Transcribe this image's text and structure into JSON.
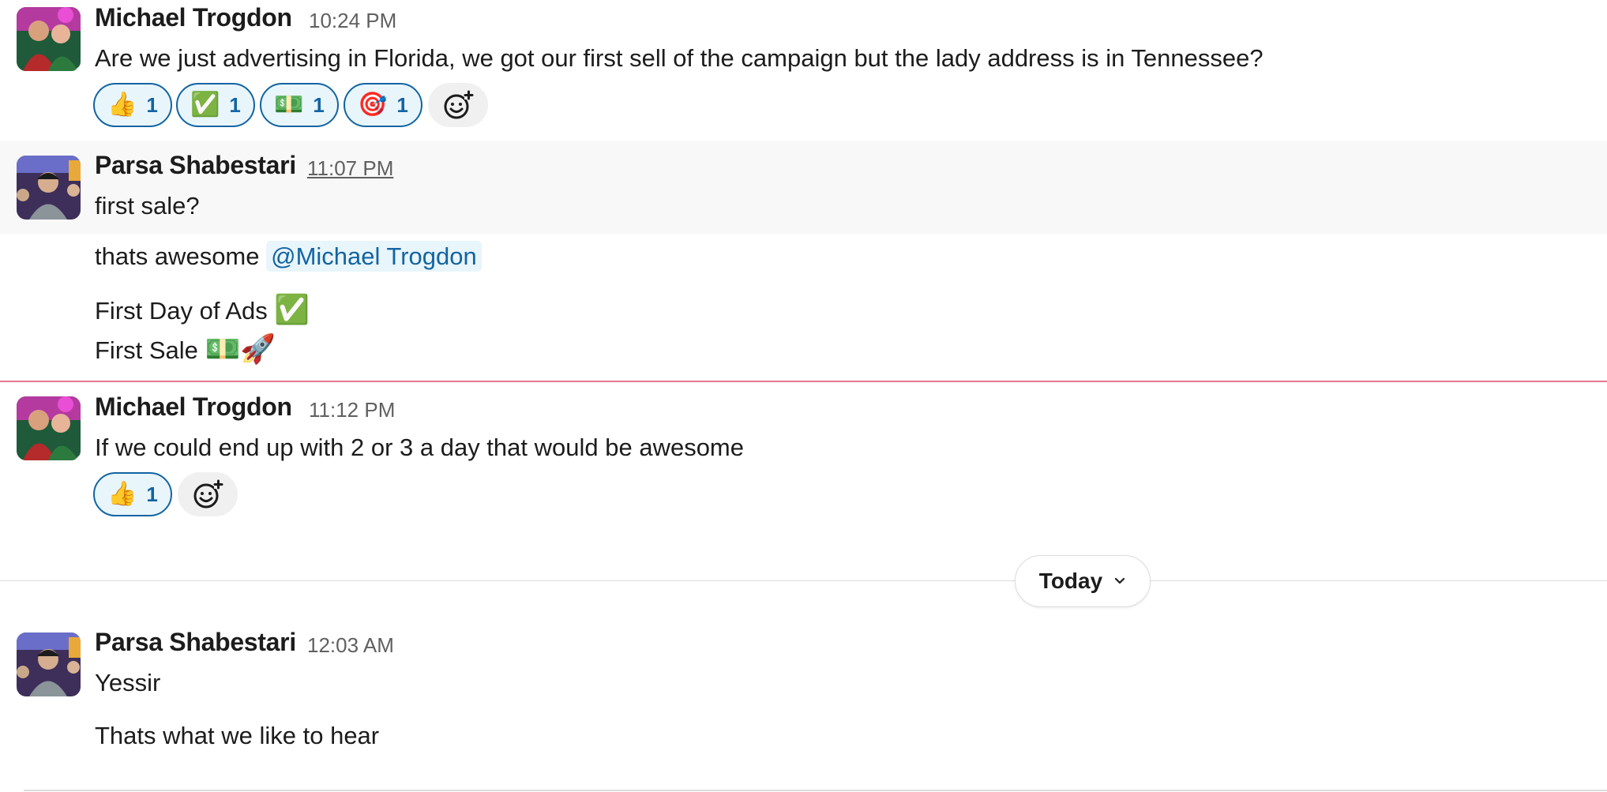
{
  "messages": [
    {
      "author": "Michael Trogdon",
      "time": "10:24 PM",
      "text": "Are we just advertising in Florida, we got our first sell of the campaign but the lady address is in Tennessee?",
      "reactions": [
        {
          "emoji": "👍",
          "count": "1"
        },
        {
          "emoji": "✅",
          "count": "1"
        },
        {
          "emoji": "💵",
          "count": "1"
        },
        {
          "emoji": "🎯",
          "count": "1"
        }
      ]
    },
    {
      "author": "Parsa Shabestari",
      "time": "11:07 PM",
      "text": "first sale?",
      "followups": {
        "line1_prefix": "thats awesome ",
        "mention": "@Michael Trogdon",
        "line2": "First Day of Ads",
        "line2_emoji": "✅",
        "line3": "First Sale",
        "line3_emoji": "💵🚀"
      }
    },
    {
      "author": "Michael Trogdon",
      "time": "11:12 PM",
      "text": "If we could end up with 2 or 3 a day that would be awesome",
      "reactions": [
        {
          "emoji": "👍",
          "count": "1"
        }
      ]
    },
    {
      "author": "Parsa Shabestari",
      "time": "12:03 AM",
      "text": "Yessir",
      "followup": "Thats what we like to hear"
    }
  ],
  "date_divider": {
    "label": "Today",
    "icon": "chevron-down-icon"
  },
  "colors": {
    "mention_bg": "#e8f5fa",
    "mention_text": "#1264a3",
    "reaction_border": "#1264a3",
    "new_messages_line": "#e8768f",
    "hover_bg": "#f8f8f8"
  }
}
